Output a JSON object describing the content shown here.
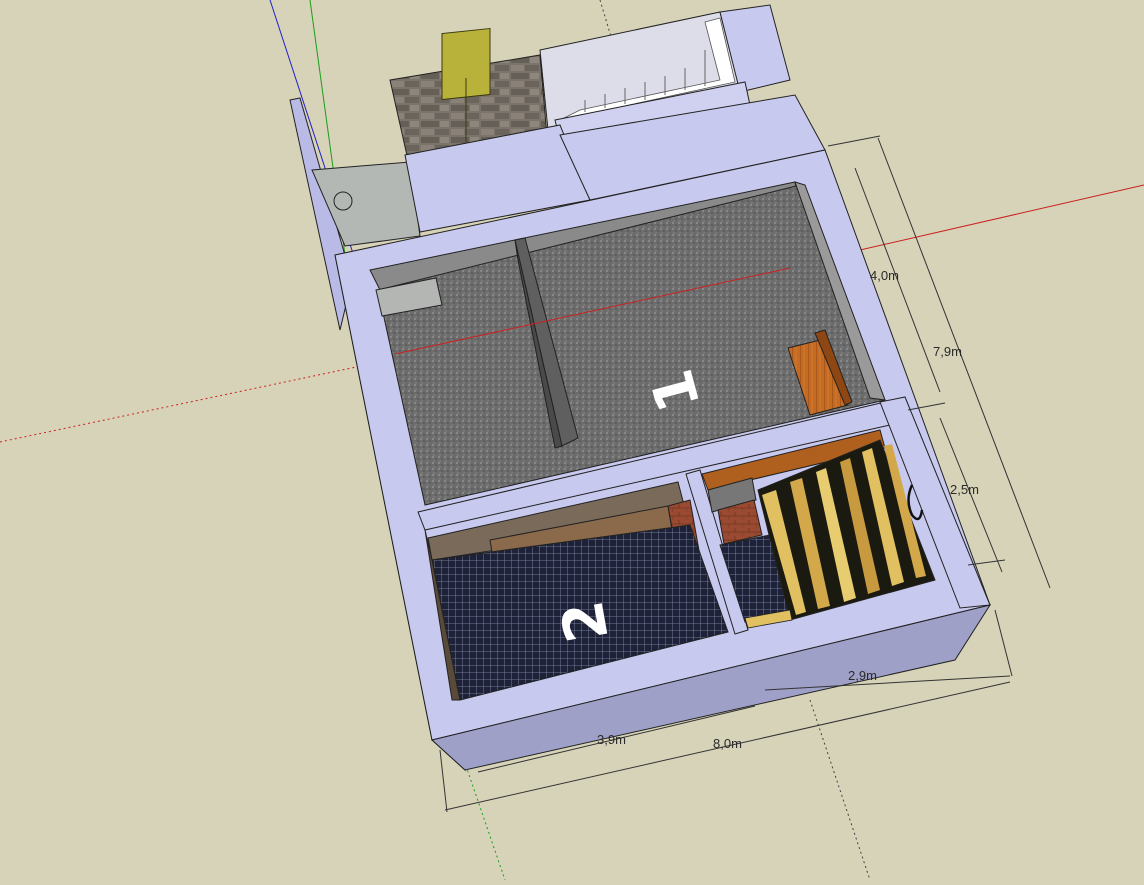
{
  "canvas": {
    "background": "#d6d3b8",
    "axis_colors": {
      "red": "#cc2020",
      "green": "#1a9e1a",
      "blue": "#2020cc"
    }
  },
  "model": {
    "wall_color": "#c8c9ee",
    "floor_main_color": "#747474",
    "room_labels": {
      "room_1": "1",
      "room_2": "2"
    },
    "icons": [
      "door-icon",
      "stairs-icon",
      "grass-planter-icon",
      "bench-icon",
      "sauna-icon",
      "circle-icon"
    ]
  },
  "dimensions": {
    "d_4_0": "4,0m",
    "d_7_9": "7,9m",
    "d_2_5": "2,5m",
    "d_2_9": "2,9m",
    "d_3_9": "3,9m",
    "d_8_0": "8,0m"
  }
}
